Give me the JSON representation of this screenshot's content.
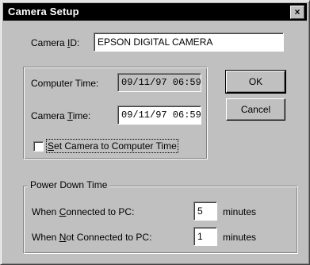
{
  "window": {
    "title": "Camera Setup",
    "close_glyph": "×"
  },
  "camera_id": {
    "label_pre": "Camera ",
    "label_key": "I",
    "label_post": "D:",
    "value": "EPSON DIGITAL CAMERA"
  },
  "time": {
    "computer_label": "Computer Time:",
    "computer_value": "09/11/97 06:59",
    "camera_label_pre": "Camera ",
    "camera_label_key": "T",
    "camera_label_post": "ime:",
    "camera_value": "09/11/97 06:59",
    "sync_key": "S",
    "sync_label_post": "et Camera to Computer Time",
    "sync_checked": false
  },
  "buttons": {
    "ok": "OK",
    "cancel": "Cancel"
  },
  "power": {
    "group_title": "Power Down Time",
    "connected_pre": "When ",
    "connected_key": "C",
    "connected_post": "onnected to PC:",
    "connected_value": "5",
    "not_connected_pre": "When ",
    "not_connected_key": "N",
    "not_connected_post": "ot Connected to PC:",
    "not_connected_value": "1",
    "unit": "minutes"
  }
}
